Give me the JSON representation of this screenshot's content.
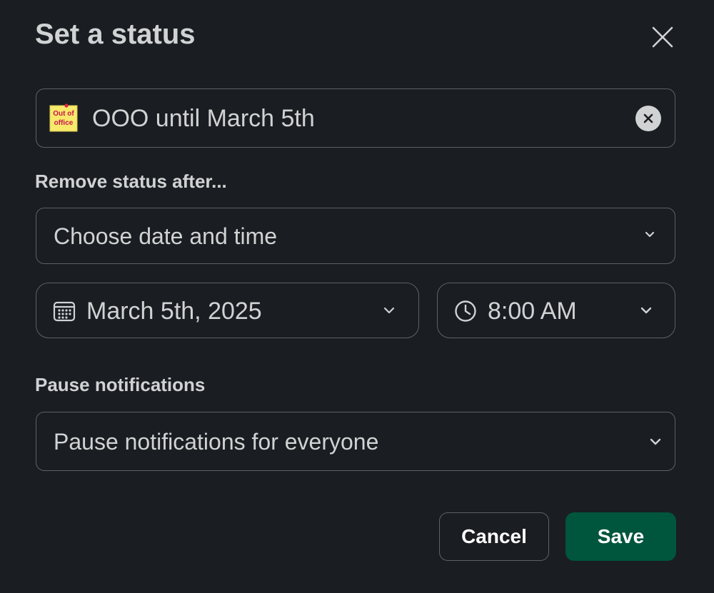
{
  "dialog": {
    "title": "Set a status"
  },
  "status": {
    "emoji_name": "out-of-office-sticky-note",
    "emoji_text_line1": "Out of",
    "emoji_text_line2": "office",
    "text": "OOO until March 5th"
  },
  "remove_after": {
    "label": "Remove status after...",
    "selected": "Choose date and time",
    "date": "March 5th, 2025",
    "time": "8:00 AM"
  },
  "notifications": {
    "label": "Pause notifications",
    "selected": "Pause notifications for everyone"
  },
  "actions": {
    "cancel_label": "Cancel",
    "save_label": "Save"
  },
  "icons": {
    "close": "close-icon",
    "clear": "clear-icon",
    "calendar": "calendar-icon",
    "clock": "clock-icon",
    "chevron": "chevron-down-icon"
  },
  "colors": {
    "background": "#1a1d21",
    "text": "#d1d2d3",
    "border": "#5f6164",
    "save": "#00553d",
    "sticky_note": "#f7e96b",
    "sticky_text": "#c8154b"
  }
}
